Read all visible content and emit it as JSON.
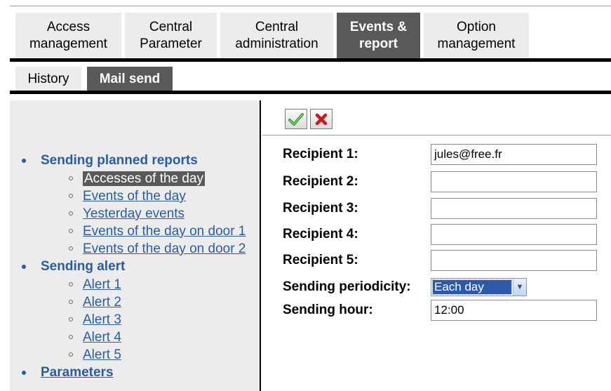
{
  "main_tabs": [
    {
      "line1": "Access",
      "line2": "management"
    },
    {
      "line1": "Central",
      "line2": "Parameter"
    },
    {
      "line1": "Central",
      "line2": "administration"
    },
    {
      "line1": "Events &",
      "line2": "report"
    },
    {
      "line1": "Option",
      "line2": "management"
    }
  ],
  "sub_tabs": [
    "History",
    "Mail send"
  ],
  "nav": {
    "group1": "Sending planned reports",
    "group1_items": [
      "Accesses of the day",
      "Events of the day",
      "Yesterday events",
      "Events of the day on door 1",
      "Events of the day on door 2"
    ],
    "group2": "Sending alert",
    "group2_items": [
      "Alert 1",
      "Alert 2",
      "Alert 3",
      "Alert 4",
      "Alert 5"
    ],
    "group3": "Parameters"
  },
  "toolbar": {
    "validate_icon": "check-icon",
    "cancel_icon": "cross-icon"
  },
  "form": {
    "recipient1_label": "Recipient 1:",
    "recipient1_value": "jules@free.fr",
    "recipient2_label": "Recipient 2:",
    "recipient2_value": "",
    "recipient3_label": "Recipient 3:",
    "recipient3_value": "",
    "recipient4_label": "Recipient 4:",
    "recipient4_value": "",
    "recipient5_label": "Recipient 5:",
    "recipient5_value": "",
    "periodicity_label": "Sending periodicity:",
    "periodicity_value": "Each day",
    "hour_label": "Sending hour:",
    "hour_value": "12:00"
  },
  "colors": {
    "active_tab": "#595959",
    "link": "#2a5da0",
    "panel": "#ececec"
  }
}
